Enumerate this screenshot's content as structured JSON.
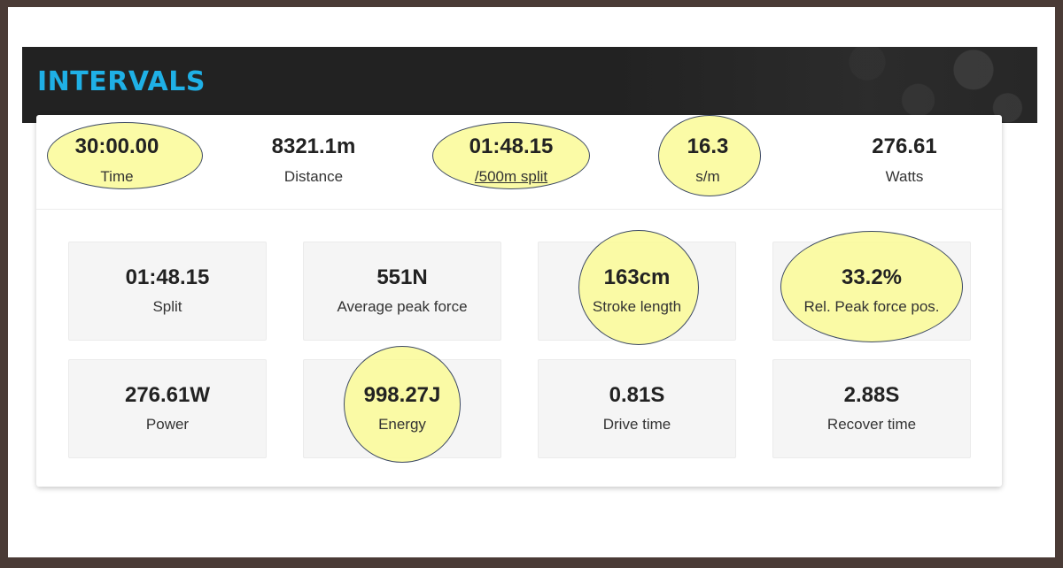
{
  "header": {
    "title": "INTERVALS"
  },
  "summary": [
    {
      "value": "30:00.00",
      "label": "Time"
    },
    {
      "value": "8321.1m",
      "label": "Distance"
    },
    {
      "value": "01:48.15",
      "label": "/500m split"
    },
    {
      "value": "16.3",
      "label": "s/m"
    },
    {
      "value": "276.61",
      "label": "Watts"
    }
  ],
  "tiles": [
    {
      "value": "01:48.15",
      "label": "Split"
    },
    {
      "value": "551N",
      "label": "Average peak force"
    },
    {
      "value": "163cm",
      "label": "Stroke length"
    },
    {
      "value": "33.2%",
      "label": "Rel. Peak force pos."
    },
    {
      "value": "276.61W",
      "label": "Power"
    },
    {
      "value": "998.27J",
      "label": "Energy"
    },
    {
      "value": "0.81S",
      "label": "Drive time"
    },
    {
      "value": "2.88S",
      "label": "Recover time"
    }
  ],
  "colors": {
    "title": "#1fb0e6",
    "banner": "#222222",
    "highlight": "#fafa96",
    "highlight_outline": "#3d4a63",
    "frame": "#4a3b36"
  }
}
